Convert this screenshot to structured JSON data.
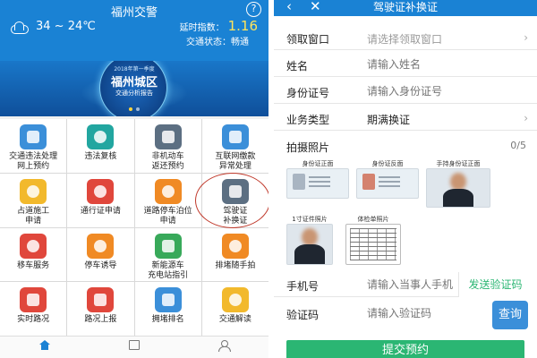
{
  "left": {
    "title": "福州交警",
    "help_icon": "?",
    "weather": {
      "icon": "cloud-icon",
      "temp": "34 ~ 24℃"
    },
    "delay_label": "延时指数：",
    "delay_value": "1.16",
    "status_text": "交通状态：畅通",
    "banner": {
      "line1": "2018年第一季度",
      "line2": "福州城区",
      "line3": "交通分析报告"
    },
    "services": [
      {
        "label": "交通违法处理\n网上预约",
        "icon": "violation-handling-icon",
        "color": "#3b8fd9"
      },
      {
        "label": "违法复核",
        "icon": "review-icon",
        "color": "#22a6a0"
      },
      {
        "label": "非机动车\n返还预约",
        "icon": "bicycle-return-icon",
        "color": "#5c6f82"
      },
      {
        "label": "互联网缴款\n异常处理",
        "icon": "payment-exception-icon",
        "color": "#3b8fd9"
      },
      {
        "label": "占道施工\n申请",
        "icon": "road-construction-icon",
        "color": "#f2b92c"
      },
      {
        "label": "通行证申请",
        "icon": "pass-permit-icon",
        "color": "#e0473c"
      },
      {
        "label": "道路停车泊位\n申请",
        "icon": "parking-berth-icon",
        "color": "#f08a24"
      },
      {
        "label": "驾驶证\n补换证",
        "icon": "license-replace-icon",
        "color": "#5c6f82"
      },
      {
        "label": "移车服务",
        "icon": "move-car-icon",
        "color": "#e0473c"
      },
      {
        "label": "停车诱导",
        "icon": "parking-guide-icon",
        "color": "#f08a24"
      },
      {
        "label": "新能源车\n充电站指引",
        "icon": "charging-station-icon",
        "color": "#38a95a"
      },
      {
        "label": "排堵随手拍",
        "icon": "snapshot-icon",
        "color": "#f08a24"
      },
      {
        "label": "实时路况",
        "icon": "traffic-light-icon",
        "color": "#e0473c"
      },
      {
        "label": "路况上报",
        "icon": "report-icon",
        "color": "#e0473c"
      },
      {
        "label": "拥堵排名",
        "icon": "congestion-rank-icon",
        "color": "#3b8fd9"
      },
      {
        "label": "交通解读",
        "icon": "itjd-icon",
        "color": "#f2b92c"
      }
    ]
  },
  "right": {
    "title": "驾驶证补换证",
    "back_icon": "‹",
    "close_icon": "✕",
    "fields": {
      "window_label": "领取窗口",
      "window_placeholder": "请选择领取窗口",
      "name_label": "姓名",
      "name_placeholder": "请输入姓名",
      "id_label": "身份证号",
      "id_placeholder": "请输入身份证号",
      "type_label": "业务类型",
      "type_value": "期满换证"
    },
    "photos": {
      "label": "拍摄照片",
      "count": "0/5",
      "id_front": "身份证正面",
      "id_back": "身份证反面",
      "hold_id": "手持身份证正面",
      "one_inch": "1寸证件照片",
      "physical": "体检单照片"
    },
    "phone_label": "手机号",
    "phone_placeholder": "请输入当事人手机",
    "send_code": "发送验证码",
    "code_label": "验证码",
    "code_placeholder": "请输入验证码",
    "query": "查询",
    "submit": "提交预约"
  },
  "colors": {
    "brand_blue": "#1a82d4",
    "action_green": "#2bb673",
    "highlight_ring": "#c0392b"
  }
}
